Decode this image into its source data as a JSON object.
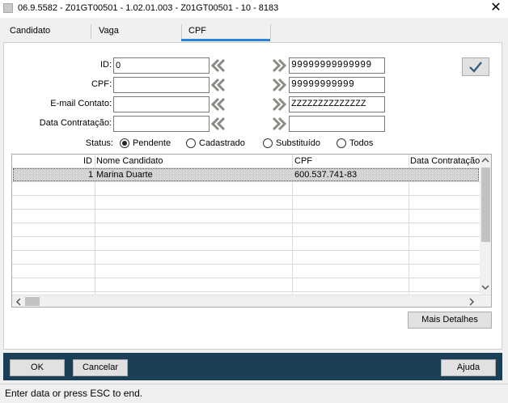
{
  "window": {
    "title": "06.9.5582 - Z01GT00501 - 1.02.01.003 - Z01GT00501 - 10 - 8183",
    "close_glyph": "✕"
  },
  "tabs": [
    {
      "label": "Candidato"
    },
    {
      "label": "Vaga"
    },
    {
      "label": "CPF"
    }
  ],
  "filters": {
    "id_label": "ID:",
    "id_from": "0",
    "id_to": "99999999999999",
    "cpf_label": "CPF:",
    "cpf_from": "",
    "cpf_to": "99999999999",
    "email_label": "E-mail Contato:",
    "email_from": "",
    "email_to": "ZZZZZZZZZZZZZZ",
    "data_label": "Data Contratação:",
    "data_from": "",
    "data_to": ""
  },
  "status": {
    "label": "Status:",
    "options": [
      {
        "label": "Pendente",
        "selected": true
      },
      {
        "label": "Cadastrado",
        "selected": false
      },
      {
        "label": "Substituído",
        "selected": false
      },
      {
        "label": "Todos",
        "selected": false
      }
    ]
  },
  "grid": {
    "columns": [
      "ID",
      "Nome Candidato",
      "CPF",
      "Data Contratação"
    ],
    "rows": [
      {
        "id": "1",
        "nome": "Marina Duarte",
        "cpf": "600.537.741-83",
        "data": ""
      }
    ]
  },
  "buttons": {
    "mais_detalhes": "Mais Detalhes",
    "ok": "OK",
    "cancelar": "Cancelar",
    "ajuda": "Ajuda"
  },
  "statusbar": {
    "text": "Enter data or press ESC to end."
  },
  "colors": {
    "accent": "#2b82d9",
    "footer": "#1b3f57",
    "chevron": "#8c8c84",
    "check": "#2d5a7a"
  },
  "icons": {
    "apply": "checkmark-icon",
    "range_from": "double-chevron-left-icon",
    "range_to": "double-chevron-right-icon"
  }
}
